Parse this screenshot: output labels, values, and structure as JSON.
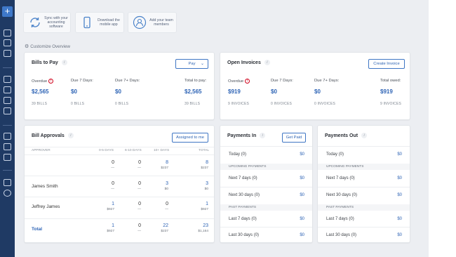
{
  "quick_links": [
    {
      "label": "Sync with your accounting software",
      "icon": "sync-icon"
    },
    {
      "label": "Download the mobile app",
      "icon": "mobile-icon"
    },
    {
      "label": "Add your team members",
      "icon": "add-user-icon"
    }
  ],
  "customize_label": "Customize Overview",
  "bills_to_pay": {
    "title": "Bills to Pay",
    "pay_button": "Pay",
    "columns": [
      {
        "label": "Overdue",
        "amount": "$2,565",
        "count": "39 BILLS",
        "warning": true
      },
      {
        "label": "Due 7 Days:",
        "amount": "$0",
        "count": "0 BILLS"
      },
      {
        "label": "Due 7+ Days:",
        "amount": "$0",
        "count": "0 BILLS"
      },
      {
        "label": "Total to pay:",
        "amount": "$2,565",
        "count": "39 BILLS"
      }
    ]
  },
  "open_invoices": {
    "title": "Open Invoices",
    "create_button": "Create Invoice",
    "columns": [
      {
        "label": "Overdue",
        "amount": "$919",
        "count": "9 INVOICES",
        "warning": true
      },
      {
        "label": "Due 7 Days:",
        "amount": "$0",
        "count": "0 INVOICES"
      },
      {
        "label": "Due 7+ Days:",
        "amount": "$0",
        "count": "0 INVOICES"
      },
      {
        "label": "Total owed:",
        "amount": "$919",
        "count": "9 INVOICES"
      }
    ]
  },
  "bill_approvals": {
    "title": "Bill Approvals",
    "assigned_button": "Assigned to me",
    "headers": [
      "APPROVER",
      "0-5 DAYS",
      "6-10 DAYS",
      "10+ DAYS",
      "TOTAL"
    ],
    "rows": [
      {
        "name": "",
        "cells": [
          {
            "v": "0",
            "s": "—"
          },
          {
            "v": "0",
            "s": "—"
          },
          {
            "v": "8",
            "s": "$237"
          },
          {
            "v": "8",
            "s": "$237"
          }
        ]
      },
      {
        "name": "James Smith",
        "cells": [
          {
            "v": "0",
            "s": "—"
          },
          {
            "v": "0",
            "s": "—"
          },
          {
            "v": "3",
            "s": "$0"
          },
          {
            "v": "3",
            "s": "$0"
          }
        ]
      },
      {
        "name": "Jeffrey James",
        "cells": [
          {
            "v": "1",
            "s": "$927"
          },
          {
            "v": "0",
            "s": "—"
          },
          {
            "v": "0",
            "s": "—"
          },
          {
            "v": "1",
            "s": "$927"
          }
        ]
      },
      {
        "name": "Total",
        "cells": [
          {
            "v": "1",
            "s": "$927"
          },
          {
            "v": "0",
            "s": "—"
          },
          {
            "v": "22",
            "s": "$237"
          },
          {
            "v": "23",
            "s": "$1,164"
          }
        ]
      }
    ]
  },
  "payments_in": {
    "title": "Payments In",
    "get_paid_button": "Get Paid",
    "today": {
      "label": "Today (0)",
      "value": "$0"
    },
    "upcoming_header": "UPCOMING PAYMENTS",
    "upcoming": [
      {
        "label": "Next 7 days (0)",
        "value": "$0"
      },
      {
        "label": "Next 30 days (0)",
        "value": "$0"
      }
    ],
    "past_header": "PAST PAYMENTS",
    "past": [
      {
        "label": "Last 7 days (0)",
        "value": "$0"
      },
      {
        "label": "Last 30 days (0)",
        "value": "$0"
      }
    ]
  },
  "payments_out": {
    "title": "Payments Out",
    "today": {
      "label": "Today (0)",
      "value": "$0"
    },
    "upcoming_header": "UPCOMING PAYMENTS",
    "upcoming": [
      {
        "label": "Next 7 days (0)",
        "value": "$0"
      },
      {
        "label": "Next 30 days (0)",
        "value": "$0"
      }
    ],
    "past_header": "PAST PAYMENTS",
    "past": [
      {
        "label": "Last 7 days (0)",
        "value": "$0"
      },
      {
        "label": "Last 30 days (0)",
        "value": "$0"
      }
    ]
  },
  "colors": {
    "rail": "#1f3a64",
    "accent": "#2d63b5",
    "overdue": "#d0021b"
  }
}
